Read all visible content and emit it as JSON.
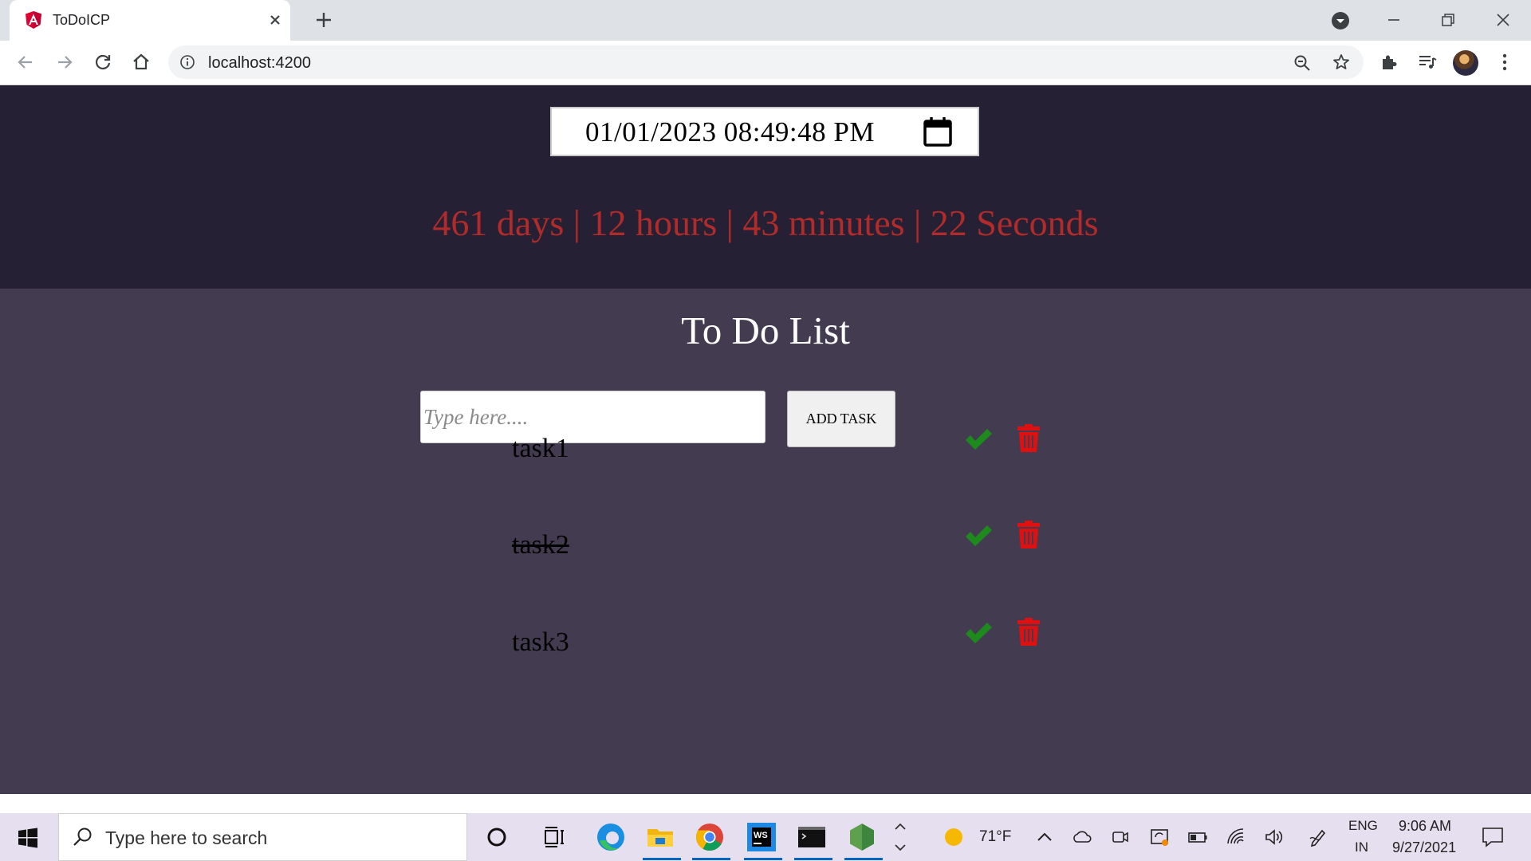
{
  "browser": {
    "tab_title": "ToDoICP",
    "url": "localhost:4200"
  },
  "app": {
    "datetime_value": "01/01/2023 08:49:48 PM",
    "countdown": "461 days | 12 hours | 43 minutes | 22 Seconds",
    "list_title": "To Do List",
    "input_placeholder": "Type here....",
    "add_button": "ADD TASK",
    "tasks": [
      {
        "name": "task1",
        "completed": false
      },
      {
        "name": "task2",
        "completed": true
      },
      {
        "name": "task3",
        "completed": false
      }
    ],
    "colors": {
      "header_bg": "#252033",
      "main_bg": "#433c50",
      "countdown": "#b22b2b",
      "check": "#1e8a1e",
      "trash": "#e01010"
    }
  },
  "taskbar": {
    "search_placeholder": "Type here to search",
    "weather": "71°F",
    "language": "ENG",
    "region": "IN",
    "time": "9:06 AM",
    "date": "9/27/2021"
  }
}
